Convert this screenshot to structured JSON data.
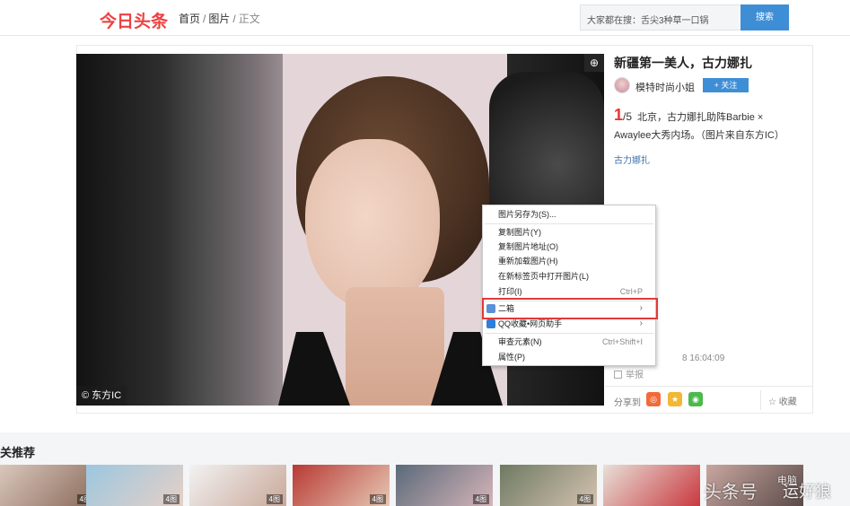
{
  "header": {
    "logo": "今日头条",
    "breadcrumb": [
      "首页",
      "图片",
      "正文"
    ],
    "search_text": "大家都在搜：舌尖3种草一口锅",
    "search_button": "搜索"
  },
  "article": {
    "title": "新疆第一美人，古力娜扎",
    "author": "模特时尚小姐",
    "follow_label": "+ 关注",
    "current_index": "1",
    "total": "/5",
    "caption": "北京，古力娜扎助阵Barbie × Awaylee大秀内场。（图片来自东方IC）",
    "tag": "古力娜扎",
    "pub_time": "8 16:04:09",
    "report": "举报",
    "share_label": "分享到",
    "favorite": "收藏",
    "photo_watermark": "© 东方IC"
  },
  "context_menu": {
    "items": [
      {
        "label": "图片另存为(S)...",
        "shortcut": ""
      },
      {
        "label": "复制图片(Y)",
        "shortcut": ""
      },
      {
        "label": "复制图片地址(O)",
        "shortcut": ""
      },
      {
        "label": "重新加载图片(H)",
        "shortcut": ""
      },
      {
        "label": "在新标签页中打开图片(L)",
        "shortcut": ""
      },
      {
        "label": "打印(I)",
        "shortcut": "Ctrl+P"
      },
      {
        "label": "二箱",
        "shortcut": ""
      },
      {
        "label": "QQ收藏•网页助手",
        "shortcut": ""
      },
      {
        "label": "审查元素(N)",
        "shortcut": "Ctrl+Shift+I"
      },
      {
        "label": "属性(P)",
        "shortcut": ""
      }
    ]
  },
  "recommend": {
    "title": "关推荐",
    "thumb_count": "4图",
    "watermark_main": "头条号",
    "watermark_small": "电脑",
    "watermark_big": "运好狼"
  },
  "colors": {
    "brand_red": "#ed4040",
    "accent_blue": "#3e8ed6",
    "highlight_red": "#e03a3a"
  }
}
